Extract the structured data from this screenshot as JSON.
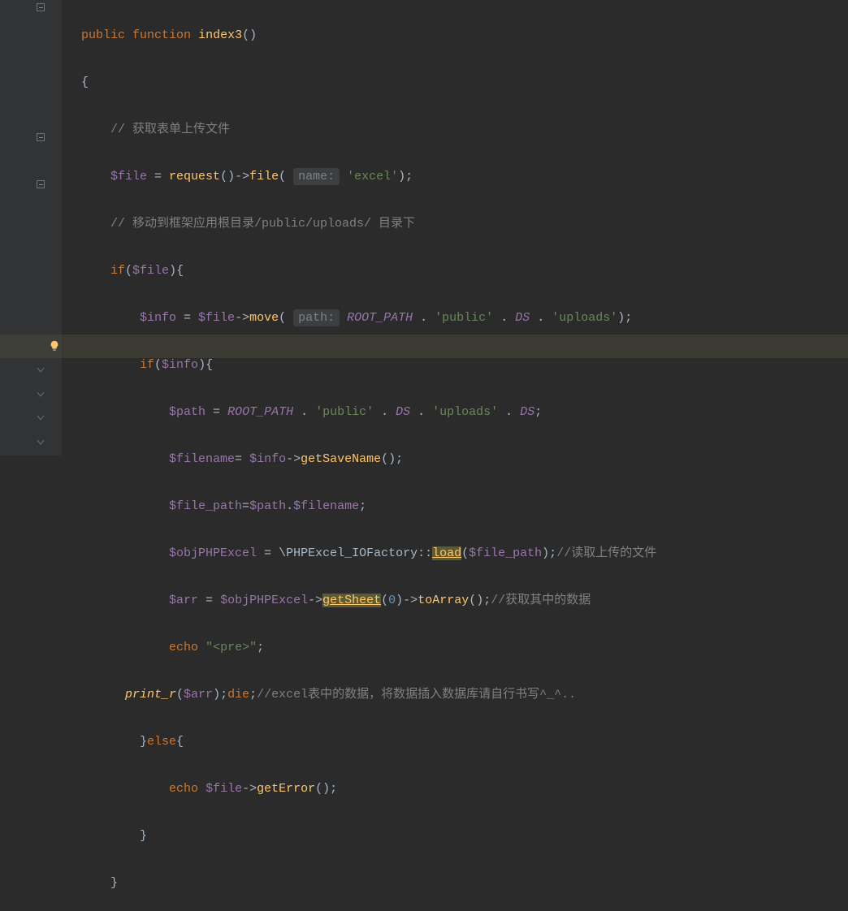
{
  "code": {
    "l1": {
      "public": "public",
      "function": "function",
      "name": "index3",
      "brackets": "()"
    },
    "l2": {
      "brace": "{"
    },
    "l3": {
      "comment": "// 获取表单上传文件"
    },
    "l4": {
      "var": "$file",
      "eq": " = ",
      "fn1": "request",
      "p1": "()",
      "arrow": "->",
      "fn2": "file",
      "p2": "( ",
      "hint": "name:",
      "sp": " ",
      "s1": "'excel'",
      "p3": ");"
    },
    "l5": {
      "comment": "// 移动到框架应用根目录/public/uploads/ 目录下"
    },
    "l6": {
      "if": "if",
      "p1": "(",
      "var": "$file",
      "p2": "){"
    },
    "l7": {
      "var1": "$info",
      "eq": " = ",
      "var2": "$file",
      "arrow": "->",
      "fn": "move",
      "p1": "( ",
      "hint": "path:",
      "sp": " ",
      "const1": "ROOT_PATH",
      "dot1": " . ",
      "s1": "'public'",
      "dot2": " . ",
      "const2": "DS",
      "dot3": " . ",
      "s2": "'uploads'",
      "p2": ");"
    },
    "l8": {
      "if": "if",
      "p1": "(",
      "var": "$info",
      "p2": "){"
    },
    "l9": {
      "var": "$path",
      "eq": " = ",
      "const1": "ROOT_PATH",
      "dot1": " . ",
      "s1": "'public'",
      "dot2": " . ",
      "const2": "DS",
      "dot3": " . ",
      "s2": "'uploads'",
      "dot4": " . ",
      "const3": "DS",
      "p": ";"
    },
    "l10": {
      "var1": "$filename",
      "eq": "= ",
      "var2": "$info",
      "arrow": "->",
      "fn": "getSaveName",
      "p": "();"
    },
    "l11": {
      "var1": "$file_path",
      "eq": "=",
      "var2": "$path",
      "dot": ".",
      "var3": "$filename",
      "p": ";"
    },
    "l12": {
      "var1": "$objPHPExcel",
      "eq": " = ",
      "ns": "\\PHPExcel_IOFactory",
      "dcolon": "::",
      "fn": "load",
      "p1": "(",
      "var2": "$file_path",
      "p2": ");",
      "comment": "//读取上传的文件"
    },
    "l13": {
      "var1": "$arr",
      "eq": " = ",
      "var2": "$objPHPExcel",
      "arrow1": "->",
      "fn1": "getSheet",
      "p1": "(",
      "num": "0",
      "p2": ")",
      "arrow2": "->",
      "fn2": "toArray",
      "p3": "();",
      "comment": "//获取其中的数据"
    },
    "l14": {
      "echo": "echo",
      "sp": " ",
      "s": "\"<pre>\"",
      "p": ";"
    },
    "l15": {
      "fn": "print_r",
      "p1": "(",
      "var": "$arr",
      "p2": ");",
      "die": "die",
      "p3": ";",
      "comment": "//excel表中的数据，将数据插入数据库请自行书写^_^.."
    },
    "l16": {
      "p1": "}",
      "else": "else",
      "p2": "{"
    },
    "l17": {
      "echo": "echo",
      "sp": " ",
      "var": "$file",
      "arrow": "->",
      "fn": "getError",
      "p": "();"
    },
    "l18": {
      "p": "}"
    },
    "l19": {
      "p": "}"
    }
  }
}
